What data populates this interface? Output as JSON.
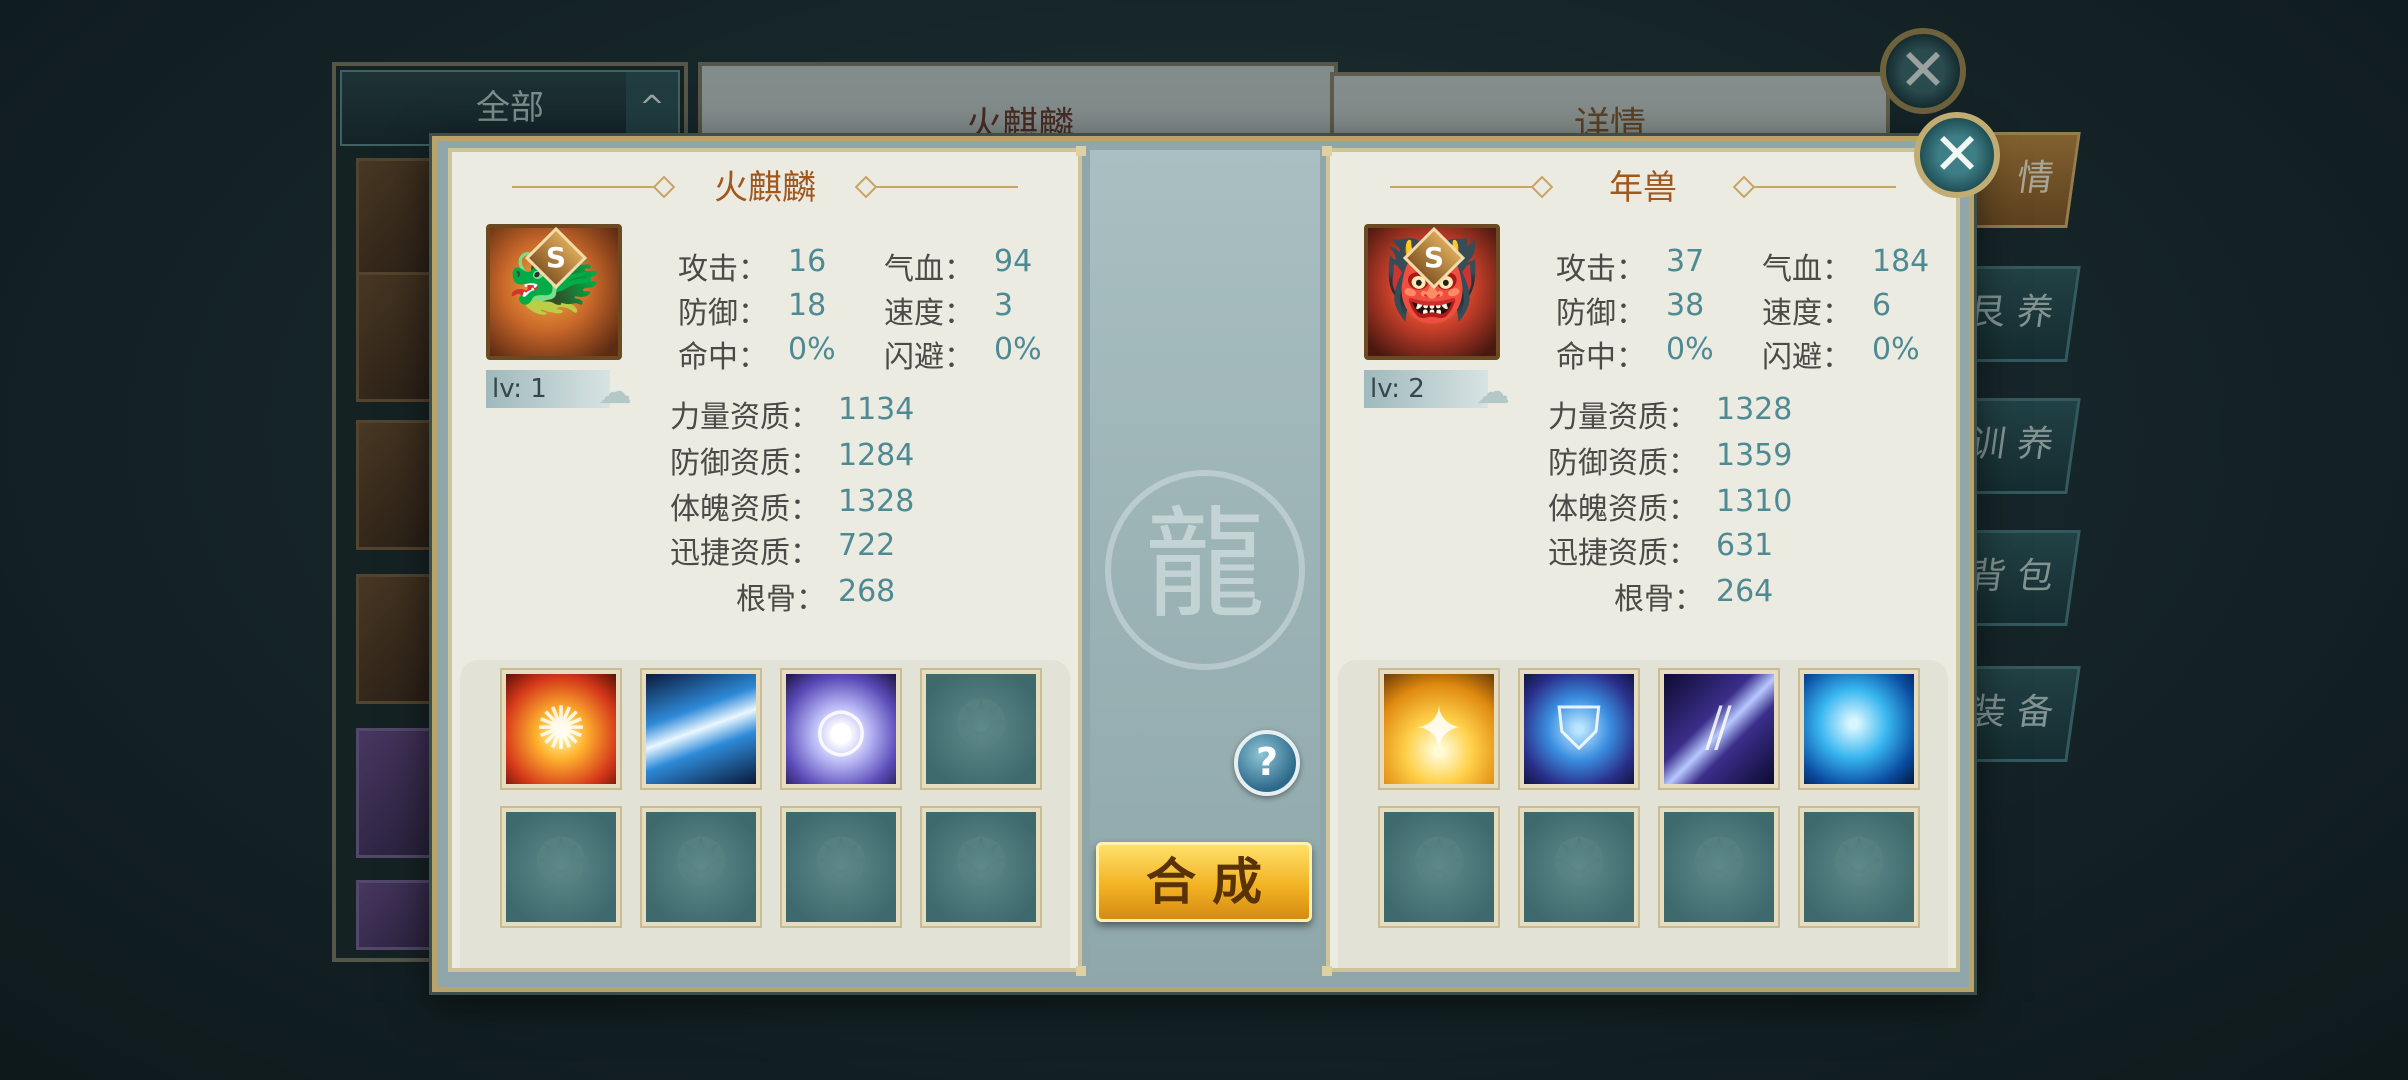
{
  "background": {
    "filter": {
      "label": "全部",
      "arrow": "^"
    },
    "center_title": "火麒麟",
    "right_title": "详情",
    "close_label": "✕",
    "side_tabs": [
      {
        "label": "情",
        "active": true
      },
      {
        "label": "艮 养",
        "active": false
      },
      {
        "label": "训 养",
        "active": false
      },
      {
        "label": "背 包",
        "active": false
      },
      {
        "label": "装 备",
        "active": false
      }
    ]
  },
  "modal": {
    "close_label": "✕",
    "help_label": "?",
    "compose_label": "合成",
    "left_pet": {
      "name": "火麒麟",
      "rank": "S",
      "level": "lv: 1",
      "icon": "fire-qilin-portrait",
      "stats": {
        "attack_label": "攻击：",
        "attack": "16",
        "hp_label": "气血：",
        "hp": "94",
        "defense_label": "防御：",
        "defense": "18",
        "speed_label": "速度：",
        "speed": "3",
        "hit_label": "命中：",
        "hit": "0%",
        "dodge_label": "闪避：",
        "dodge": "0%"
      },
      "aptitudes": {
        "power_label": "力量资质：",
        "power": "1134",
        "defense_label": "防御资质：",
        "defense": "1284",
        "physique_label": "体魄资质：",
        "physique": "1328",
        "agility_label": "迅捷资质：",
        "agility": "722",
        "root_label": "根骨：",
        "root": "268"
      },
      "skills": [
        "fire-burst-skill-icon",
        "wind-slash-skill-icon",
        "spirit-orb-skill-icon",
        "empty",
        "empty",
        "empty",
        "empty",
        "empty"
      ]
    },
    "right_pet": {
      "name": "年兽",
      "rank": "S",
      "level": "lv: 2",
      "icon": "nian-beast-portrait",
      "stats": {
        "attack_label": "攻击：",
        "attack": "37",
        "hp_label": "气血：",
        "hp": "184",
        "defense_label": "防御：",
        "defense": "38",
        "speed_label": "速度：",
        "speed": "6",
        "hit_label": "命中：",
        "hit": "0%",
        "dodge_label": "闪避：",
        "dodge": "0%"
      },
      "aptitudes": {
        "power_label": "力量资质：",
        "power": "1328",
        "defense_label": "防御资质：",
        "defense": "1359",
        "physique_label": "体魄资质：",
        "physique": "1310",
        "agility_label": "迅捷资质：",
        "agility": "631",
        "root_label": "根骨：",
        "root": "264"
      },
      "skills": [
        "golden-blaze-skill-icon",
        "shield-skill-icon",
        "claw-strike-skill-icon",
        "ice-beast-skill-icon",
        "empty",
        "empty",
        "empty",
        "empty"
      ]
    }
  },
  "colors": {
    "title_orange": "#a0581f",
    "value_teal": "#4e8a93",
    "compose_gold": "#f2b323",
    "panel_cream": "#ecebe2"
  }
}
